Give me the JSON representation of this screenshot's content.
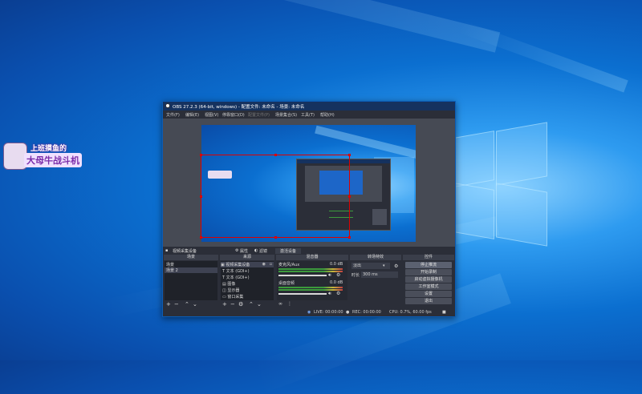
{
  "sticker": {
    "line1": "上班摸鱼的",
    "line2": "大母牛战斗机"
  },
  "obs": {
    "title": "OBS 27.2.3 (64-bit, windows) - 配置文件: 未命名 - 场景: 未命名",
    "controls": {
      "header": "控件",
      "buttons": [
        "停止推流",
        "开始录制",
        "启动虚拟摄像机",
        "工作室模式",
        "设置",
        "退出"
      ]
    },
    "menu": [
      {
        "label": "文件(F)"
      },
      {
        "label": "编辑(E)"
      },
      {
        "label": "视图(V)"
      },
      {
        "label": "停靠窗口(D)"
      },
      {
        "label": "配置文件(P)",
        "disabled": true
      },
      {
        "label": "场景集合(S)"
      },
      {
        "label": "工具(T)"
      },
      {
        "label": "帮助(H)"
      }
    ],
    "source_bar": {
      "current_source": "视频采集设备",
      "properties": "属性",
      "filters": "滤镜",
      "activate": "激活设备"
    },
    "scenes": {
      "header": "场景",
      "items": [
        "场景",
        "场景 2"
      ]
    },
    "sources": {
      "header": "来源",
      "items": [
        {
          "icon": "camera-icon",
          "label": "视频采集设备"
        },
        {
          "icon": "text-icon",
          "label": "文本 (GDI+)"
        },
        {
          "icon": "text-icon",
          "label": "文本 (GDI+)"
        },
        {
          "icon": "image-icon",
          "label": "图像"
        },
        {
          "icon": "monitor-icon",
          "label": "显示器"
        },
        {
          "icon": "window-icon",
          "label": "窗口采集"
        }
      ]
    },
    "mixer": {
      "header": "混音器",
      "channels": [
        {
          "name": "麦克风/Aux",
          "db": "0.0 dB"
        },
        {
          "name": "桌面音频",
          "db": "0.0 dB"
        }
      ]
    },
    "transitions": {
      "header": "转场特效",
      "type": "淡出",
      "duration_label": "时长",
      "duration_value": "300 ms"
    },
    "status": {
      "live": "LIVE: 00:00:00",
      "rec": "REC: 00:00:00",
      "cpu": "CPU: 0.7%, 60.00 fps"
    }
  }
}
